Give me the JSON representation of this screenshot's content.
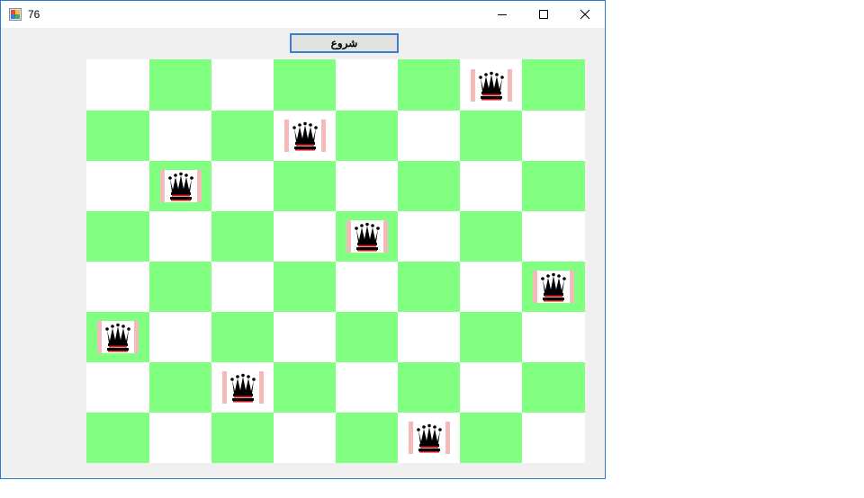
{
  "window": {
    "title": "76",
    "icon": "winforms-app-icon",
    "controls": [
      "minimize-icon",
      "maximize-icon",
      "close-icon"
    ]
  },
  "toolbar": {
    "start_label": "شروع"
  },
  "board": {
    "size": 8,
    "colors": {
      "light": "#ffffff",
      "dark": "#80ff80",
      "queen_frame": "#f4b9b9"
    },
    "queen_icon": "queen-icon",
    "queens": [
      {
        "row": 0,
        "col": 6
      },
      {
        "row": 1,
        "col": 3
      },
      {
        "row": 2,
        "col": 1
      },
      {
        "row": 3,
        "col": 4
      },
      {
        "row": 4,
        "col": 7
      },
      {
        "row": 5,
        "col": 0
      },
      {
        "row": 6,
        "col": 2
      },
      {
        "row": 7,
        "col": 5
      }
    ]
  }
}
